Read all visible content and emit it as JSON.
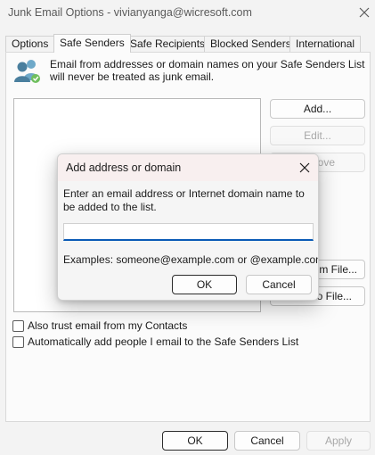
{
  "window": {
    "title": "Junk Email Options - vivianyanga@wicresoft.com"
  },
  "tabs": [
    {
      "label": "Options",
      "active": false
    },
    {
      "label": "Safe Senders",
      "active": true
    },
    {
      "label": "Safe Recipients",
      "active": false
    },
    {
      "label": "Blocked Senders",
      "active": false
    },
    {
      "label": "International",
      "active": false
    }
  ],
  "safe_senders": {
    "description": "Email from addresses or domain names on your Safe Senders List will never be treated as junk email.",
    "add_label": "Add...",
    "edit_label": "Edit...",
    "remove_label_visible": "ove",
    "import_label_visible": "om File...",
    "export_label_visible": "to File...",
    "list_items": []
  },
  "checkboxes": {
    "trust_contacts": {
      "label": "Also trust email from my Contacts",
      "checked": false
    },
    "auto_add": {
      "label": "Automatically add people I email to the Safe Senders List",
      "checked": false
    }
  },
  "footer": {
    "ok_label": "OK",
    "cancel_label": "Cancel",
    "apply_label": "Apply"
  },
  "dialog": {
    "title": "Add address or domain",
    "prompt": "Enter an email address or Internet domain name to be added to the list.",
    "input_value": "",
    "examples": "Examples: someone@example.com or @example.com",
    "ok_label": "OK",
    "cancel_label": "Cancel"
  },
  "colors": {
    "window_bg": "#f3f3f3",
    "panel_bg": "#fbfbfb",
    "dialog_title_bg": "#f8efef",
    "input_focus": "#0a5ab6",
    "icon_teal": "#4a7f9e",
    "icon_blue": "#6ea9c9",
    "icon_green": "#6fbf5e"
  },
  "icons": {
    "close": "close-icon",
    "safe_senders": "people-icon"
  }
}
